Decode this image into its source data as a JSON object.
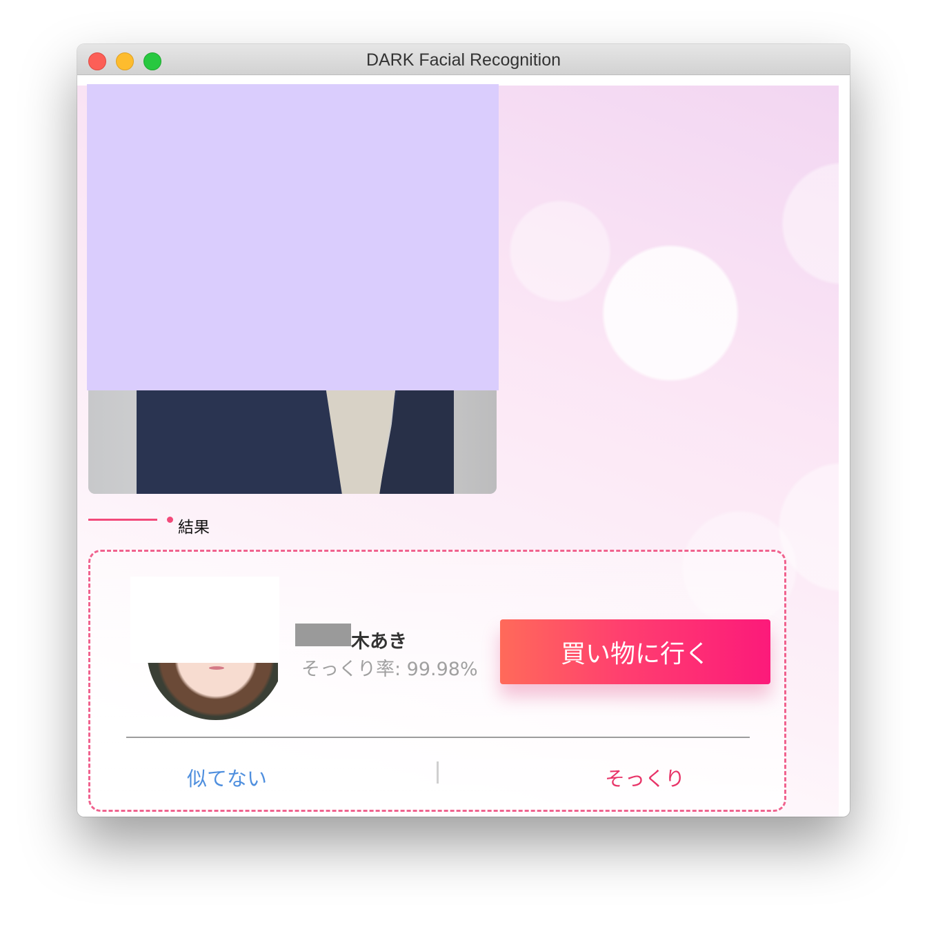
{
  "window": {
    "title": "DARK Facial Recognition"
  },
  "section": {
    "label": "結果"
  },
  "result": {
    "name": "木あき",
    "similarity": "そっくり率: 99.98%",
    "shop_button_label": "買い物に行く",
    "not_similar_label": "似てない",
    "very_similar_label": "そっくり"
  },
  "colors": {
    "accent": "#f24a7a",
    "button_gradient_start": "#ff6a5a",
    "button_gradient_end": "#fc1a7a",
    "not_similar": "#4f8fde",
    "very_similar": "#e83468",
    "face_mask": "#dacdfd"
  }
}
